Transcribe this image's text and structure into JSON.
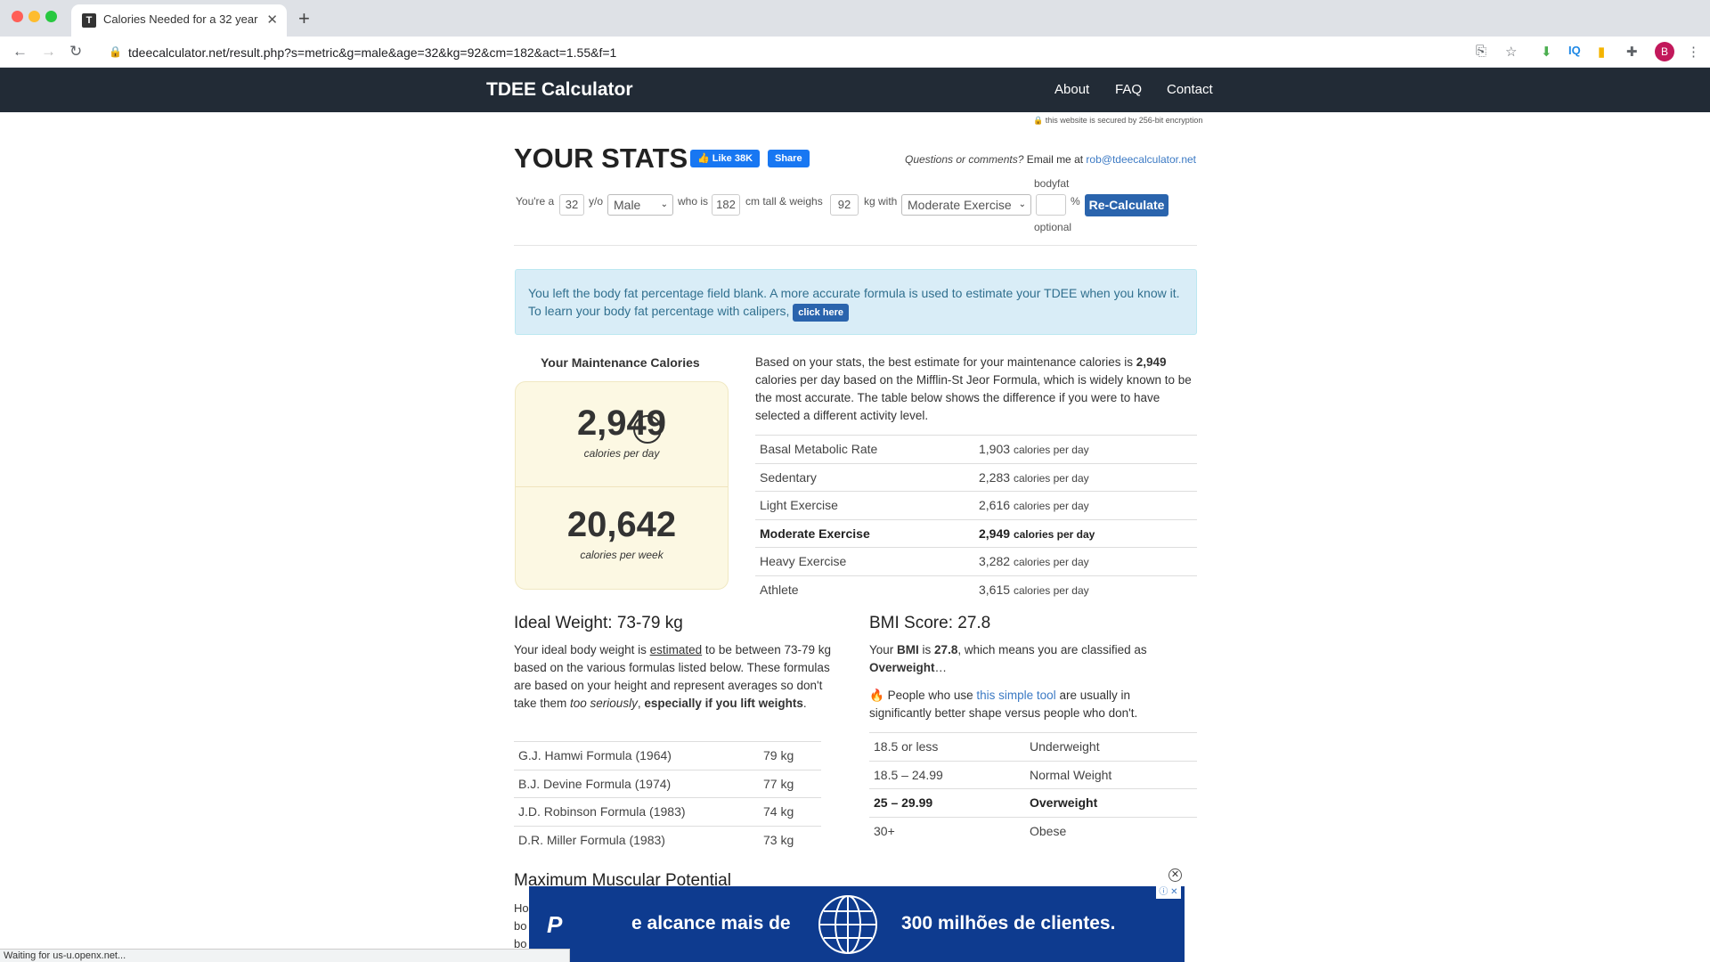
{
  "browser": {
    "tab_title": "Calories Needed for a 32 year",
    "url": "tdeecalculator.net/result.php?s=metric&g=male&age=32&kg=92&cm=182&act=1.55&f=1",
    "profile_initial": "B",
    "status_text": "Waiting for us-u.openx.net..."
  },
  "header": {
    "brand": "TDEE Calculator",
    "nav": [
      "About",
      "FAQ",
      "Contact"
    ],
    "secured": "this website is secured by 256-bit encryption"
  },
  "stats": {
    "title": "YOUR STATS",
    "fb_like": "Like 38K",
    "fb_share": "Share",
    "questions_prefix": "Questions or comments?",
    "questions_mid": " Email me at ",
    "email": "rob@tdeecalculator.net",
    "form": {
      "youre_a": "You're a",
      "age": "32",
      "yo": "y/o",
      "gender": "Male",
      "who_is": "who is",
      "height": "182",
      "cm_tall": "cm tall & weighs",
      "weight": "92",
      "kg_with": "kg with",
      "activity": "Moderate Exercise",
      "bodyfat_label": "bodyfat",
      "bodyfat_value": "",
      "percent": "%",
      "optional": "optional",
      "recalc": "Re-Calculate"
    }
  },
  "alert": {
    "text": "You left the body fat percentage field blank. A more accurate formula is used to estimate your TDEE when you know it. To learn your body fat percentage with calipers, ",
    "button": "click here"
  },
  "maintenance": {
    "title": "Your Maintenance Calories",
    "per_day": "2,949",
    "per_day_label": "calories per day",
    "per_week": "20,642",
    "per_week_label": "calories per week",
    "desc_1": "Based on your stats, the best estimate for your maintenance calories is ",
    "desc_bold": "2,949",
    "desc_2": " calories per day based on the Mifflin-St Jeor Formula, which is widely known to be the most accurate. The table below shows the difference if you were to have selected a different activity level.",
    "levels": [
      {
        "name": "Basal Metabolic Rate",
        "value": "1,903",
        "unit": "calories per day"
      },
      {
        "name": "Sedentary",
        "value": "2,283",
        "unit": "calories per day"
      },
      {
        "name": "Light Exercise",
        "value": "2,616",
        "unit": "calories per day"
      },
      {
        "name": "Moderate Exercise",
        "value": "2,949",
        "unit": "calories per day"
      },
      {
        "name": "Heavy Exercise",
        "value": "3,282",
        "unit": "calories per day"
      },
      {
        "name": "Athlete",
        "value": "3,615",
        "unit": "calories per day"
      }
    ]
  },
  "ideal": {
    "title": "Ideal Weight: 73-79 kg",
    "p1": "Your ideal body weight is ",
    "p_link": "estimated",
    "p2": " to be between 73-79 kg based on the various formulas listed below. These formulas are based on your height and represent averages so don't take them ",
    "p_em": "too seriously",
    "p3": ", ",
    "p_bold": "especially if you lift weights",
    "p4": ".",
    "formulas": [
      {
        "name": "G.J. Hamwi Formula (1964)",
        "value": "79 kg"
      },
      {
        "name": "B.J. Devine Formula (1974)",
        "value": "77 kg"
      },
      {
        "name": "J.D. Robinson Formula (1983)",
        "value": "74 kg"
      },
      {
        "name": "D.R. Miller Formula (1983)",
        "value": "73 kg"
      }
    ]
  },
  "bmi": {
    "title": "BMI Score: 27.8",
    "p1": "Your ",
    "p_bmi": "BMI",
    "p2": " is ",
    "p_val": "27.8",
    "p3": ", which means you are classified as ",
    "p_class": "Overweight",
    "p4": "…",
    "tool_1": " People who use ",
    "tool_link": "this simple tool",
    "tool_2": " are usually in significantly better shape versus people who don't.",
    "ranges": [
      {
        "range": "18.5 or less",
        "label": "Underweight"
      },
      {
        "range": "18.5 – 24.99",
        "label": "Normal Weight"
      },
      {
        "range": "25 – 29.99",
        "label": "Overweight"
      },
      {
        "range": "30+",
        "label": "Obese"
      }
    ]
  },
  "max": {
    "title": "Maximum Muscular Potential",
    "partial_lines": [
      "Ho",
      "bo",
      "bo"
    ]
  },
  "ad": {
    "text1": "e alcance mais de",
    "text2": "300 milhões de clientes."
  }
}
